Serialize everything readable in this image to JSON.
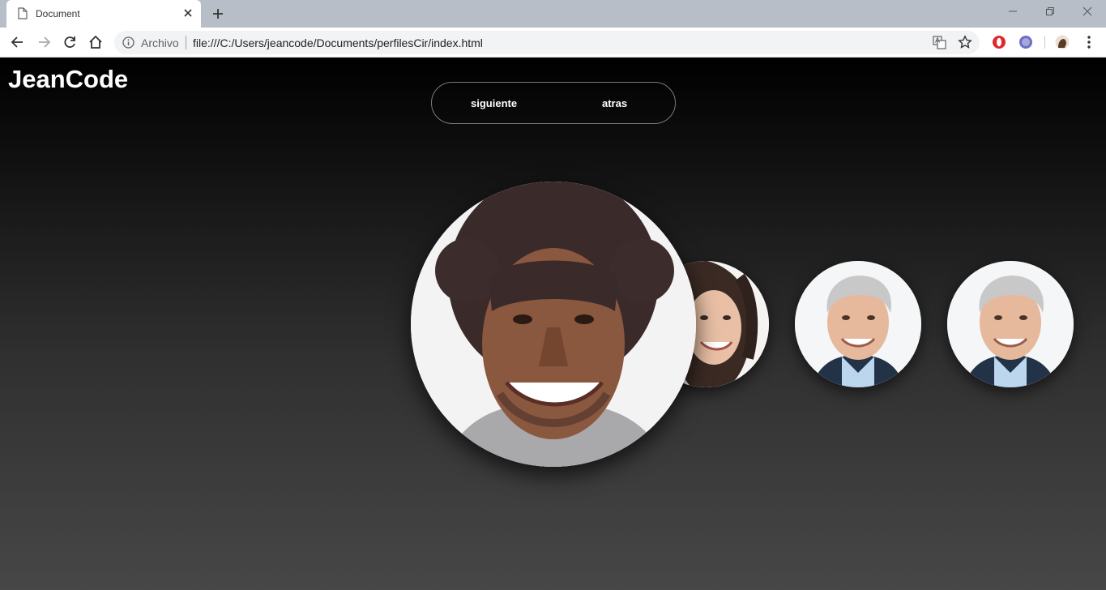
{
  "browser": {
    "tab_title": "Document",
    "security_label": "Archivo",
    "url": "file:///C:/Users/jeancode/Documents/perfilesCir/index.html"
  },
  "page": {
    "brand": "JeanCode",
    "nav": {
      "next_label": "siguiente",
      "back_label": "atras"
    },
    "profiles": [
      {
        "name": "man-curly-hair",
        "state": "active"
      },
      {
        "name": "smiling-woman",
        "state": "inactive"
      },
      {
        "name": "gray-haired-man",
        "state": "inactive"
      },
      {
        "name": "gray-haired-man",
        "state": "inactive"
      }
    ]
  },
  "colors": {
    "page_top": "#000000",
    "page_bottom": "#474747",
    "pill_border": "#7a7a7a",
    "text": "#ffffff"
  },
  "icons": [
    "page-icon",
    "close-icon",
    "plus-icon",
    "minimize-icon",
    "maximize-icon",
    "window-close-icon",
    "back-arrow-icon",
    "forward-arrow-icon",
    "reload-icon",
    "home-icon",
    "info-icon",
    "translate-icon",
    "star-icon",
    "opera-icon",
    "extension-icon",
    "profile-avatar-icon",
    "kebab-menu-icon"
  ]
}
